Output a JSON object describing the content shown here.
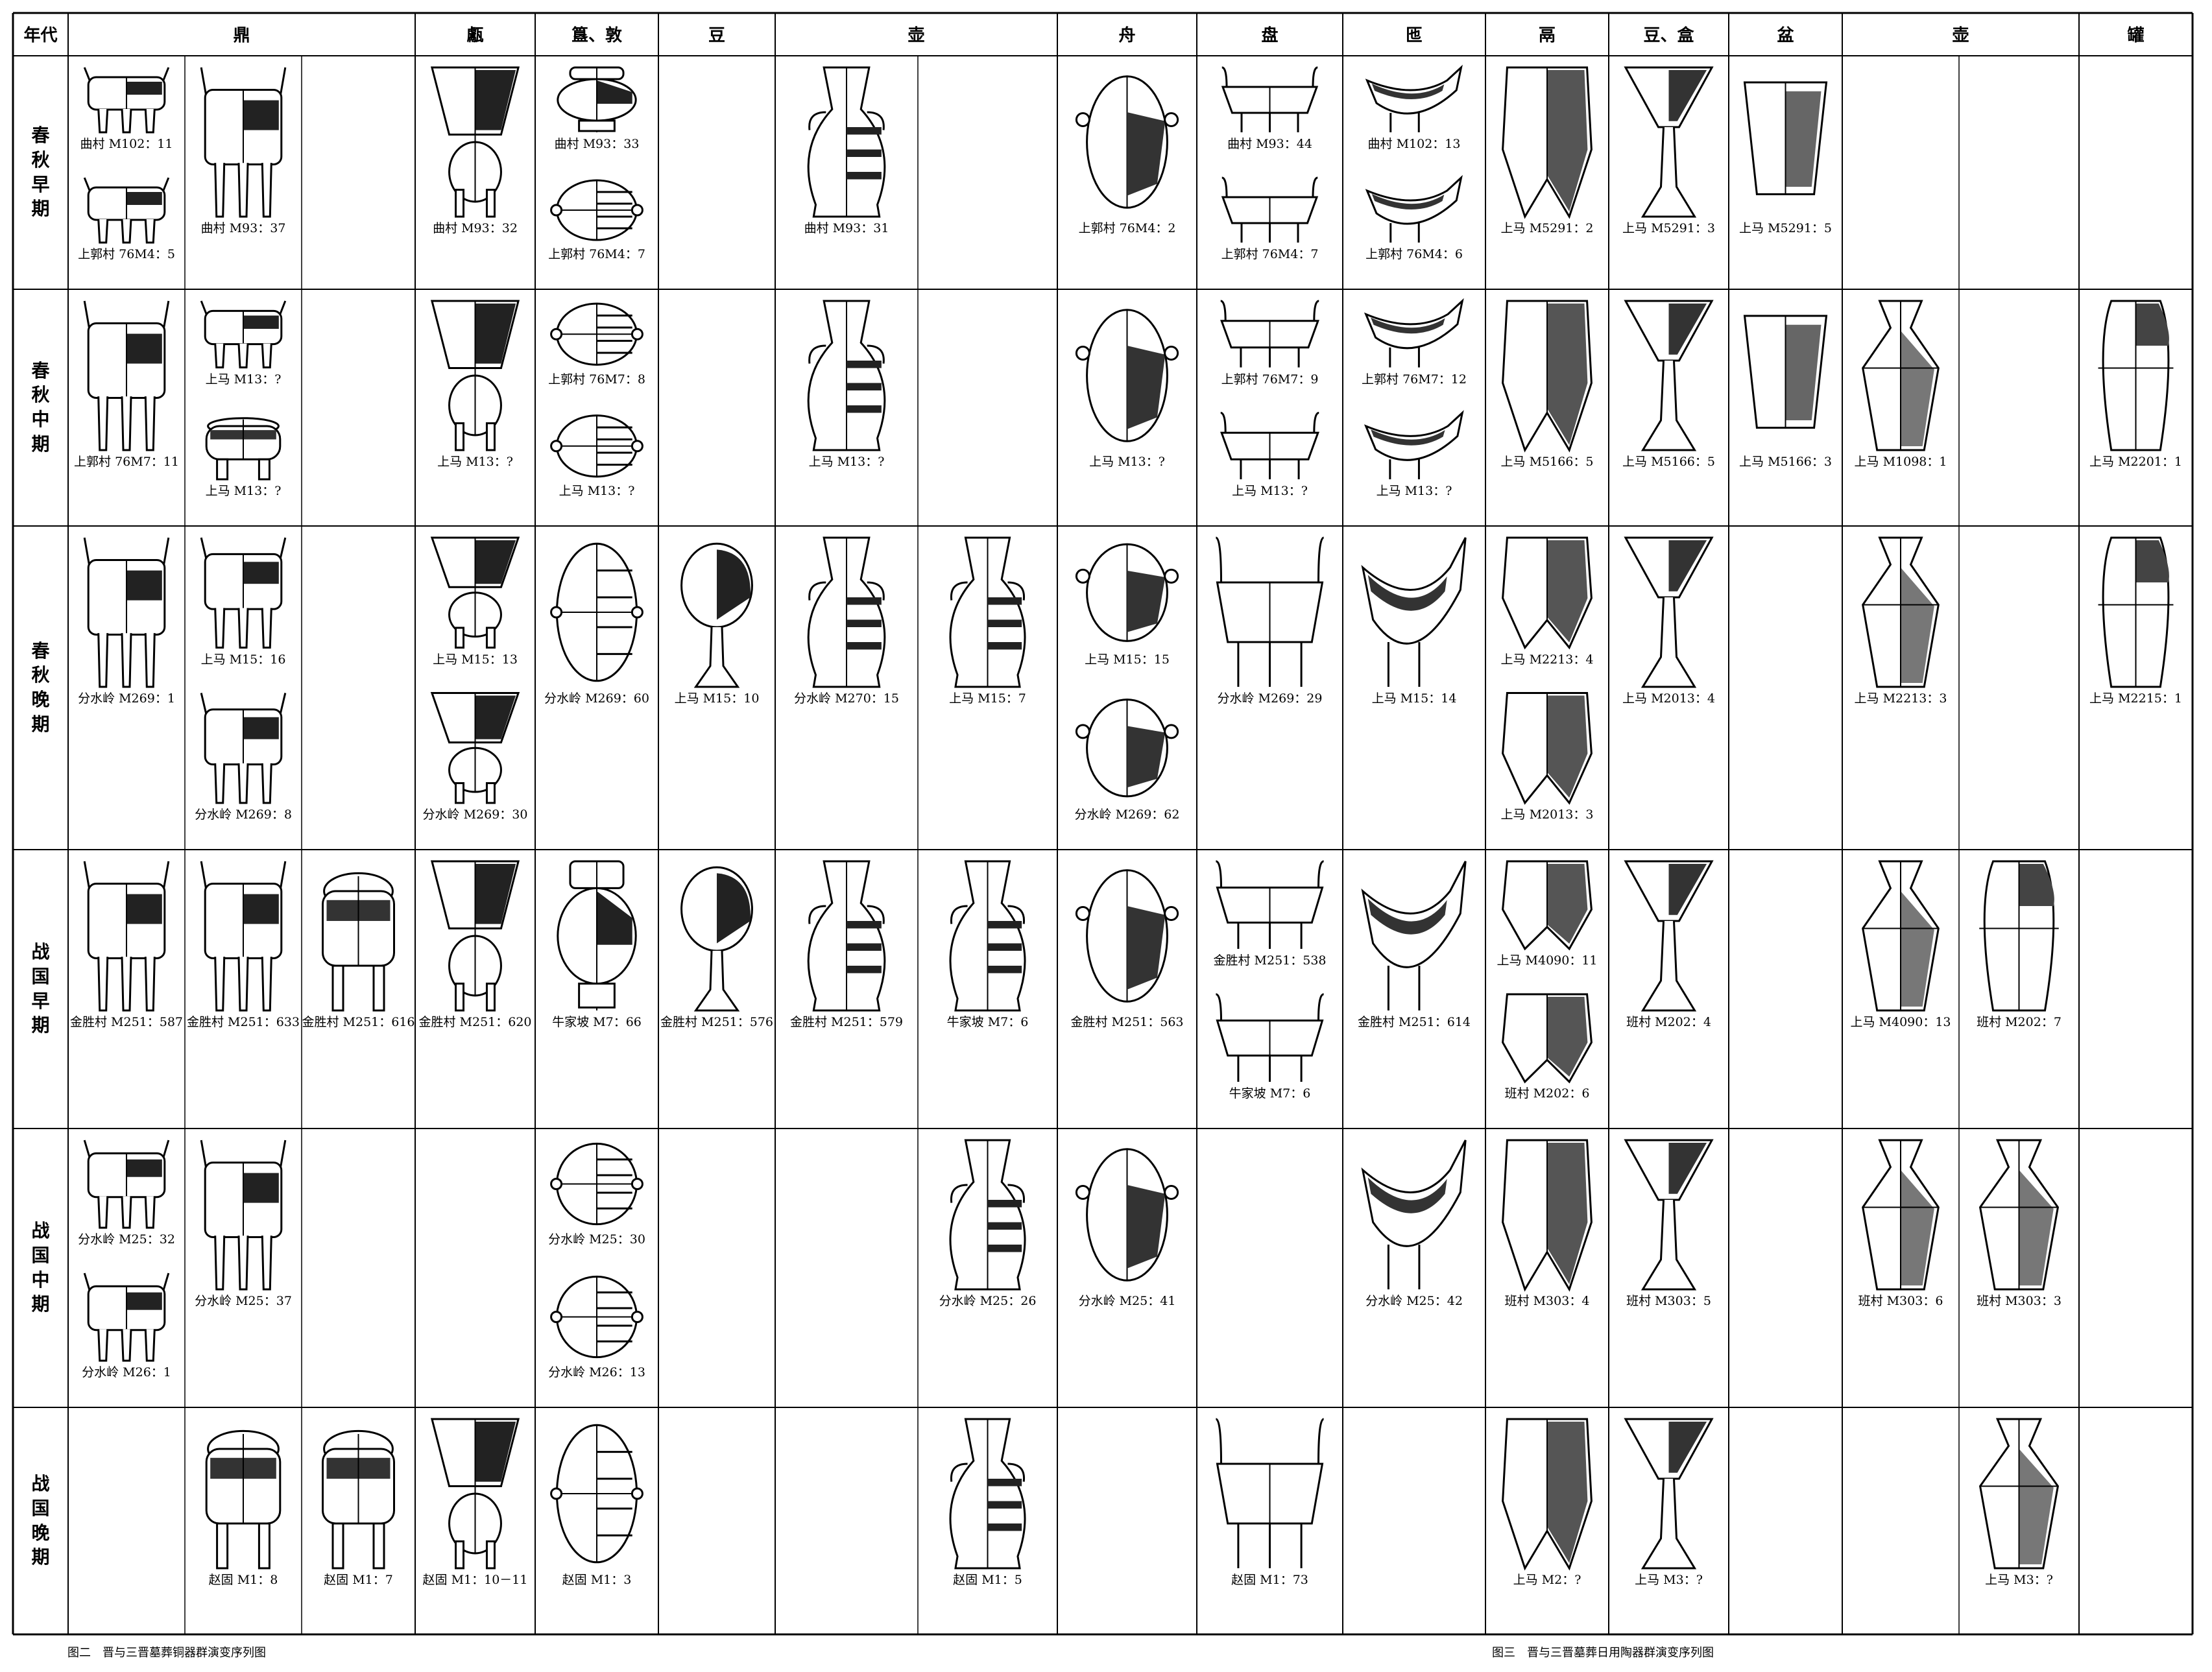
{
  "header": {
    "era_label": "年代",
    "types": [
      "鼎",
      "甗",
      "簋、敦",
      "豆",
      "壶",
      "舟",
      "盘",
      "匜",
      "鬲",
      "豆、盒",
      "盆",
      "壶",
      "罐"
    ]
  },
  "periods": [
    "春秋早期",
    "春秋中期",
    "春秋晚期",
    "战国早期",
    "战国中期",
    "战国晚期"
  ],
  "vessels": [
    {
      "row": 0,
      "col": 0,
      "shape": "ding-legs",
      "label": "曲村 M102：11"
    },
    {
      "row": 0,
      "col": 0,
      "shape": "ding-legs",
      "label": "上郭村 76M4：5"
    },
    {
      "row": 0,
      "col": 1,
      "shape": "ding-legs",
      "label": "曲村 M93：37"
    },
    {
      "row": 0,
      "col": 3,
      "shape": "yan",
      "label": "曲村 M93：32"
    },
    {
      "row": 0,
      "col": 4,
      "shape": "gui",
      "label": "曲村 M93：33"
    },
    {
      "row": 0,
      "col": 4,
      "shape": "dui",
      "label": "上郭村 76M4：7"
    },
    {
      "row": 0,
      "col": 6,
      "shape": "hu",
      "label": "曲村 M93：31"
    },
    {
      "row": 0,
      "col": 8,
      "shape": "zhou",
      "label": "上郭村 76M4：2"
    },
    {
      "row": 0,
      "col": 9,
      "shape": "pan",
      "label": "曲村 M93：44"
    },
    {
      "row": 0,
      "col": 9,
      "shape": "pan",
      "label": "上郭村 76M4：7"
    },
    {
      "row": 0,
      "col": 10,
      "shape": "yi",
      "label": "曲村 M102：13"
    },
    {
      "row": 0,
      "col": 10,
      "shape": "yi",
      "label": "上郭村 76M4：6"
    },
    {
      "row": 0,
      "col": 11,
      "shape": "li",
      "label": "上马 M5291：2"
    },
    {
      "row": 0,
      "col": 12,
      "shape": "dou",
      "label": "上马 M5291：3"
    },
    {
      "row": 0,
      "col": 13,
      "shape": "pen",
      "label": "上马 M5291：5"
    },
    {
      "row": 1,
      "col": 0,
      "shape": "ding-legs",
      "label": "上郭村 76M7：11"
    },
    {
      "row": 1,
      "col": 1,
      "shape": "ding-legs",
      "label": "上马 M13：?"
    },
    {
      "row": 1,
      "col": 1,
      "shape": "ding-lid",
      "label": "上马 M13：?"
    },
    {
      "row": 1,
      "col": 3,
      "shape": "yan",
      "label": "上马 M13：?"
    },
    {
      "row": 1,
      "col": 4,
      "shape": "dui",
      "label": "上郭村 76M7：8"
    },
    {
      "row": 1,
      "col": 4,
      "shape": "dui",
      "label": "上马 M13：?"
    },
    {
      "row": 1,
      "col": 6,
      "shape": "hu",
      "label": "上马 M13：?"
    },
    {
      "row": 1,
      "col": 8,
      "shape": "zhou",
      "label": "上马 M13：?"
    },
    {
      "row": 1,
      "col": 9,
      "shape": "pan",
      "label": "上郭村 76M7：9"
    },
    {
      "row": 1,
      "col": 9,
      "shape": "pan",
      "label": "上马 M13：?"
    },
    {
      "row": 1,
      "col": 10,
      "shape": "yi",
      "label": "上郭村 76M7：12"
    },
    {
      "row": 1,
      "col": 10,
      "shape": "yi",
      "label": "上马 M13：?"
    },
    {
      "row": 1,
      "col": 11,
      "shape": "li",
      "label": "上马 M5166：5"
    },
    {
      "row": 1,
      "col": 12,
      "shape": "dou",
      "label": "上马 M5166：5"
    },
    {
      "row": 1,
      "col": 13,
      "shape": "pen",
      "label": "上马 M5166：3"
    },
    {
      "row": 1,
      "col": 14,
      "shape": "pothu",
      "label": "上马 M1098：1"
    },
    {
      "row": 1,
      "col": 16,
      "shape": "guan",
      "label": "上马 M2201：1"
    },
    {
      "row": 2,
      "col": 0,
      "shape": "ding-legs",
      "label": "分水岭 M269：1"
    },
    {
      "row": 2,
      "col": 1,
      "shape": "ding-legs",
      "label": "上马 M15：16"
    },
    {
      "row": 2,
      "col": 1,
      "shape": "ding-legs",
      "label": "分水岭 M269：8"
    },
    {
      "row": 2,
      "col": 3,
      "shape": "yan",
      "label": "上马 M15：13"
    },
    {
      "row": 2,
      "col": 3,
      "shape": "yan",
      "label": "分水岭 M269：30"
    },
    {
      "row": 2,
      "col": 4,
      "shape": "dui",
      "label": "分水岭 M269：60"
    },
    {
      "row": 2,
      "col": 5,
      "shape": "bdou",
      "label": "上马 M15：10"
    },
    {
      "row": 2,
      "col": 6,
      "shape": "hu",
      "label": "分水岭 M270：15"
    },
    {
      "row": 2,
      "col": 7,
      "shape": "hu",
      "label": "上马 M15：7"
    },
    {
      "row": 2,
      "col": 8,
      "shape": "zhou",
      "label": "上马 M15：15"
    },
    {
      "row": 2,
      "col": 8,
      "shape": "zhou",
      "label": "分水岭 M269：62"
    },
    {
      "row": 2,
      "col": 9,
      "shape": "pan",
      "label": "分水岭 M269：29"
    },
    {
      "row": 2,
      "col": 10,
      "shape": "yi",
      "label": "上马 M15：14"
    },
    {
      "row": 2,
      "col": 11,
      "shape": "li",
      "label": "上马 M2213：4"
    },
    {
      "row": 2,
      "col": 11,
      "shape": "li",
      "label": "上马 M2013：3"
    },
    {
      "row": 2,
      "col": 12,
      "shape": "dou",
      "label": "上马 M2013：4"
    },
    {
      "row": 2,
      "col": 14,
      "shape": "pothu",
      "label": "上马 M2213：3"
    },
    {
      "row": 2,
      "col": 16,
      "shape": "guan",
      "label": "上马 M2215：1"
    },
    {
      "row": 3,
      "col": 0,
      "shape": "ding-legs",
      "label": "金胜村 M251：587"
    },
    {
      "row": 3,
      "col": 1,
      "shape": "ding-legs",
      "label": "金胜村 M251：633"
    },
    {
      "row": 3,
      "col": 2,
      "shape": "ding-lid",
      "label": "金胜村 M251：616"
    },
    {
      "row": 3,
      "col": 3,
      "shape": "yan",
      "label": "金胜村 M251：620"
    },
    {
      "row": 3,
      "col": 4,
      "shape": "gui",
      "label": "牛家坡 M7：66"
    },
    {
      "row": 3,
      "col": 5,
      "shape": "bdou",
      "label": "金胜村 M251：576"
    },
    {
      "row": 3,
      "col": 6,
      "shape": "hu",
      "label": "金胜村 M251：579"
    },
    {
      "row": 3,
      "col": 7,
      "shape": "hu",
      "label": "牛家坡 M7：6"
    },
    {
      "row": 3,
      "col": 8,
      "shape": "zhou",
      "label": "金胜村 M251：563"
    },
    {
      "row": 3,
      "col": 9,
      "shape": "pan",
      "label": "金胜村 M251：538"
    },
    {
      "row": 3,
      "col": 9,
      "shape": "pan",
      "label": "牛家坡 M7：6"
    },
    {
      "row": 3,
      "col": 10,
      "shape": "yi",
      "label": "金胜村 M251：614"
    },
    {
      "row": 3,
      "col": 11,
      "shape": "li",
      "label": "上马 M4090：11"
    },
    {
      "row": 3,
      "col": 11,
      "shape": "li",
      "label": "班村 M202：6"
    },
    {
      "row": 3,
      "col": 12,
      "shape": "dou",
      "label": "班村 M202：4"
    },
    {
      "row": 3,
      "col": 14,
      "shape": "pothu",
      "label": "上马 M4090：13"
    },
    {
      "row": 3,
      "col": 15,
      "shape": "guan",
      "label": "班村 M202：7"
    },
    {
      "row": 4,
      "col": 0,
      "shape": "ding-legs",
      "label": "分水岭 M25：32"
    },
    {
      "row": 4,
      "col": 0,
      "shape": "ding-legs",
      "label": "分水岭 M26：1"
    },
    {
      "row": 4,
      "col": 1,
      "shape": "ding-legs",
      "label": "分水岭 M25：37"
    },
    {
      "row": 4,
      "col": 4,
      "shape": "dui",
      "label": "分水岭 M25：30"
    },
    {
      "row": 4,
      "col": 4,
      "shape": "dui",
      "label": "分水岭 M26：13"
    },
    {
      "row": 4,
      "col": 7,
      "shape": "hu",
      "label": "分水岭 M25：26"
    },
    {
      "row": 4,
      "col": 8,
      "shape": "zhou",
      "label": "分水岭 M25：41"
    },
    {
      "row": 4,
      "col": 10,
      "shape": "yi",
      "label": "分水岭 M25：42"
    },
    {
      "row": 4,
      "col": 11,
      "shape": "li",
      "label": "班村 M303：4"
    },
    {
      "row": 4,
      "col": 12,
      "shape": "dou",
      "label": "班村 M303：5"
    },
    {
      "row": 4,
      "col": 14,
      "shape": "pothu",
      "label": "班村 M303：6"
    },
    {
      "row": 4,
      "col": 15,
      "shape": "pothu",
      "label": "班村 M303：3"
    },
    {
      "row": 5,
      "col": 1,
      "shape": "ding-lid",
      "label": "赵固 M1：8"
    },
    {
      "row": 5,
      "col": 2,
      "shape": "ding-lid",
      "label": "赵固 M1：7"
    },
    {
      "row": 5,
      "col": 3,
      "shape": "yan",
      "label": "赵固 M1：10－11"
    },
    {
      "row": 5,
      "col": 4,
      "shape": "dui",
      "label": "赵固 M1：3"
    },
    {
      "row": 5,
      "col": 7,
      "shape": "hu",
      "label": "赵固 M1：5"
    },
    {
      "row": 5,
      "col": 9,
      "shape": "pan",
      "label": "赵固 M1：73"
    },
    {
      "row": 5,
      "col": 11,
      "shape": "li",
      "label": "上马 M2：?"
    },
    {
      "row": 5,
      "col": 12,
      "shape": "dou",
      "label": "上马 M3：?"
    },
    {
      "row": 5,
      "col": 15,
      "shape": "pothu",
      "label": "上马 M3：?"
    }
  ],
  "captions": {
    "left": "图二　晋与三晋墓葬铜器群演变序列图",
    "right": "图三　晋与三晋墓葬日用陶器群演变序列图"
  }
}
